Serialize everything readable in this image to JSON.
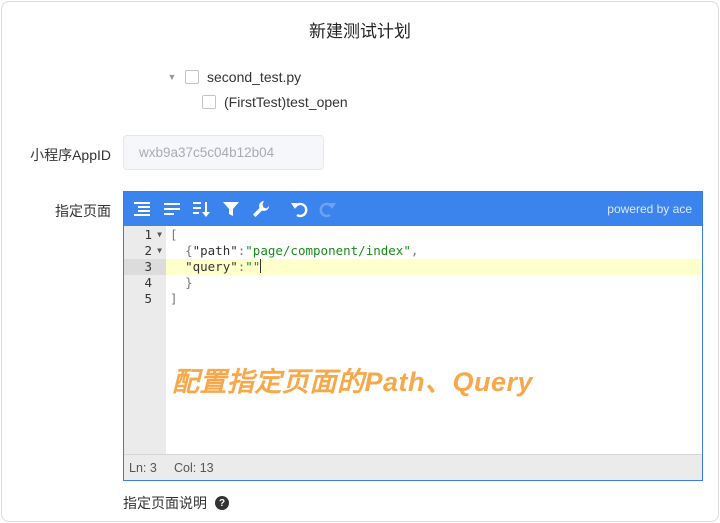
{
  "dialog": {
    "title": "新建测试计划"
  },
  "tree": {
    "file": {
      "label": "second_test.py",
      "checked": false,
      "expanded": true
    },
    "case": {
      "label": "(FirstTest)test_open",
      "checked": false
    }
  },
  "form": {
    "appid": {
      "label": "小程序AppID",
      "placeholder": "wxb9a37c5c04b12b04"
    },
    "pages": {
      "label": "指定页面"
    },
    "pages_desc": {
      "label": "指定页面说明",
      "help_icon": "question-circle-icon"
    }
  },
  "editor": {
    "powered_by": "powered by ace",
    "toolbar_icons": [
      "format-indent-icon",
      "align-text-icon",
      "sort-icon",
      "filter-icon",
      "wrench-icon",
      "undo-icon",
      "redo-icon"
    ],
    "line_numbers": [
      "1",
      "2",
      "3",
      "4",
      "5"
    ],
    "active_line": 3,
    "code_lines": [
      {
        "indent": "",
        "open": "["
      },
      {
        "indent": "  ",
        "open": "{",
        "key": "\"path\"",
        "sep": ":",
        "value": "\"page/component/index\"",
        "close": ","
      },
      {
        "indent": "  ",
        "key": "\"query\"",
        "sep": ":",
        "value": "\"\""
      },
      {
        "indent": "  ",
        "close": "}"
      },
      {
        "indent": "",
        "close": "]"
      }
    ],
    "status": {
      "line": "Ln: 3",
      "col": "Col: 13"
    },
    "colors": {
      "toolbar": "#3c84ed",
      "active_line": "#ffffcc",
      "string": "#1a8a1a"
    }
  },
  "annotation": {
    "text": "配置指定页面的Path、Query",
    "color": "#f7a84a"
  }
}
